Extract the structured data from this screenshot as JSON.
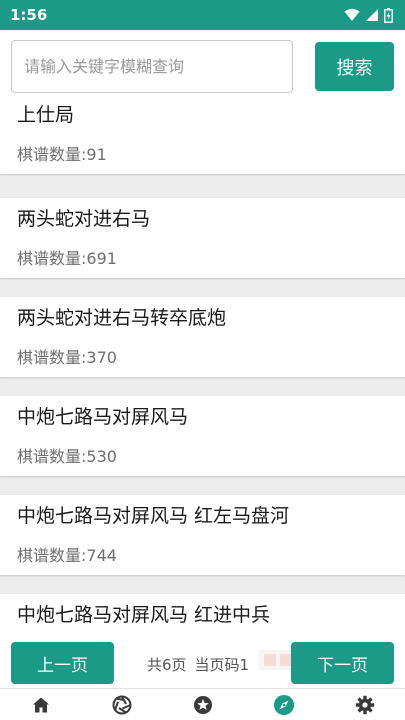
{
  "status_bar": {
    "time": "1:56",
    "icons": [
      "wifi-icon",
      "signal-icon",
      "battery-icon"
    ]
  },
  "search": {
    "placeholder": "请输入关键字模糊查询",
    "value": "",
    "button_label": "搜索"
  },
  "list": {
    "items": [
      {
        "title": "上仕局",
        "count": "棋谱数量:91"
      },
      {
        "title": "两头蛇对进右马",
        "count": "棋谱数量:691"
      },
      {
        "title": "两头蛇对进右马转卒底炮",
        "count": "棋谱数量:370"
      },
      {
        "title": "中炮七路马对屏风马",
        "count": "棋谱数量:530"
      },
      {
        "title": "中炮七路马对屏风马 红左马盘河",
        "count": "棋谱数量:744"
      },
      {
        "title": "中炮七路马对屏风马 红进中兵",
        "count": ""
      }
    ]
  },
  "pager": {
    "prev_label": "上一页",
    "total_pages": "共6页",
    "current_page": "当页码1",
    "next_label": "下一页"
  },
  "bottom_nav": {
    "items": [
      {
        "icon": "home-icon",
        "active": false
      },
      {
        "icon": "aperture-icon",
        "active": false
      },
      {
        "icon": "star-icon",
        "active": false
      },
      {
        "icon": "compass-icon",
        "active": true
      },
      {
        "icon": "gear-icon",
        "active": false
      }
    ]
  },
  "colors": {
    "accent": "#1a9a87",
    "background": "#ececec",
    "nav_icon": "#3a3a3a"
  }
}
